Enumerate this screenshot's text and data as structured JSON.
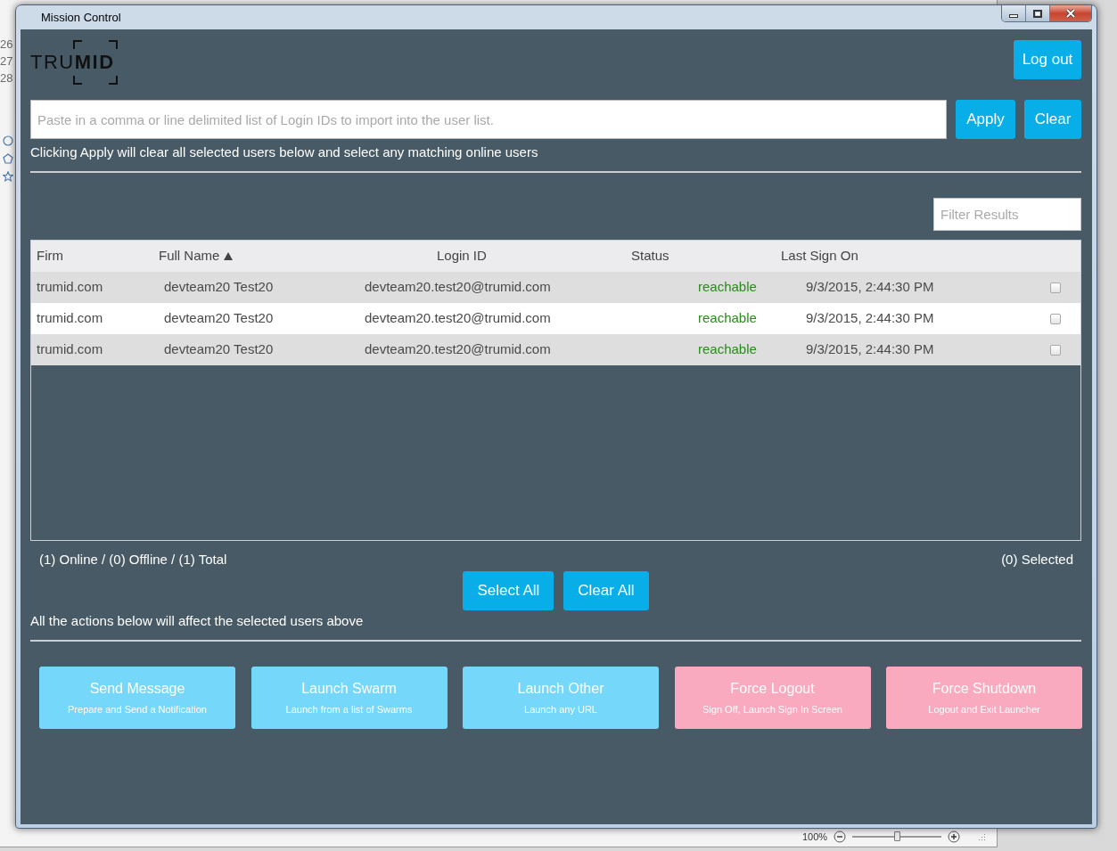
{
  "background_window": {
    "line_numbers": [
      "26",
      "27",
      "28"
    ],
    "zoom_level": "100%",
    "zoom_slider": {
      "level": 0.5
    }
  },
  "window": {
    "title": "Mission Control"
  },
  "header": {
    "logo": {
      "light": "TRU",
      "bold": "MID"
    },
    "logout_button": "Log out"
  },
  "import": {
    "placeholder": "Paste in a comma or line delimited list of Login IDs to import into the user list.",
    "apply_button": "Apply",
    "clear_button": "Clear",
    "hint": "Clicking Apply will clear all selected users below and select any matching online users"
  },
  "filter": {
    "placeholder": "Filter Results"
  },
  "table": {
    "columns": [
      {
        "label": "Firm",
        "sorted": false
      },
      {
        "label": "Full Name",
        "sorted": true
      },
      {
        "label": "Login ID",
        "sorted": false
      },
      {
        "label": "Status",
        "sorted": false
      },
      {
        "label": "Last Sign On",
        "sorted": false
      }
    ],
    "rows": [
      {
        "firm": "trumid.com",
        "full_name": "devteam20 Test20",
        "login_id": "devteam20.test20@trumid.com",
        "status": "reachable",
        "last_sign_on": "9/3/2015, 2:44:30 PM",
        "checked": false
      },
      {
        "firm": "trumid.com",
        "full_name": "devteam20 Test20",
        "login_id": "devteam20.test20@trumid.com",
        "status": "reachable",
        "last_sign_on": "9/3/2015, 2:44:30 PM",
        "checked": false
      },
      {
        "firm": "trumid.com",
        "full_name": "devteam20 Test20",
        "login_id": "devteam20.test20@trumid.com",
        "status": "reachable",
        "last_sign_on": "9/3/2015, 2:44:30 PM",
        "checked": false
      }
    ]
  },
  "summary": {
    "counts": "(1) Online / (0) Offline / (1) Total",
    "selected": "(0) Selected"
  },
  "bulk_buttons": [
    "Select All",
    "Clear All"
  ],
  "actions_note": "All the actions below will affect the selected users above",
  "actions": [
    {
      "title": "Send Message",
      "subtitle": "Prepare and Send a Notification",
      "color": "#75d8fa"
    },
    {
      "title": "Launch Swarm",
      "subtitle": "Launch from a list of Swarms",
      "color": "#75d8fa"
    },
    {
      "title": "Launch Other",
      "subtitle": "Launch any URL",
      "color": "#75d8fa"
    },
    {
      "title": "Force Logout",
      "subtitle": "Sign Off, Launch Sign In Screen",
      "color": "#f9aabf"
    },
    {
      "title": "Force Shutdown",
      "subtitle": "Logout and Exit Launcher",
      "color": "#f9aabf"
    }
  ]
}
